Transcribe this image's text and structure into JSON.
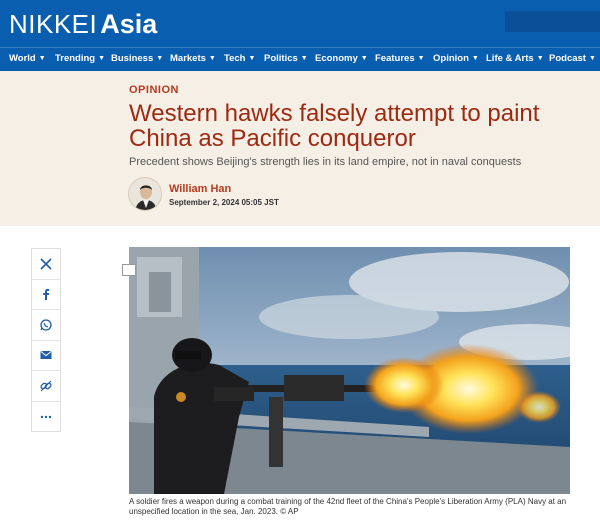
{
  "header": {
    "logo_primary": "NIKKEI",
    "logo_secondary": "Asia",
    "brand_color": "#0a5eb0"
  },
  "nav": {
    "items": [
      {
        "label": "World"
      },
      {
        "label": "Trending"
      },
      {
        "label": "Business"
      },
      {
        "label": "Markets"
      },
      {
        "label": "Tech"
      },
      {
        "label": "Politics"
      },
      {
        "label": "Economy"
      },
      {
        "label": "Features"
      },
      {
        "label": "Opinion"
      },
      {
        "label": "Life & Arts"
      },
      {
        "label": "Podcast"
      }
    ]
  },
  "article": {
    "kicker": "OPINION",
    "headline": "Western hawks falsely attempt to paint China as Pacific conqueror",
    "subhead": "Precedent shows Beijing's strength lies in its land empire, not in naval conquests",
    "author": "William Han",
    "date": "September 2, 2024 05:05 JST",
    "caption": "A soldier fires a weapon during a combat training of the 42nd fleet of the China's People's Liberation Army (PLA) Navy at an unspecified location in the sea, Jan. 2023.  © AP"
  },
  "share": {
    "icons": [
      "x-icon",
      "facebook-icon",
      "whatsapp-icon",
      "email-icon",
      "link-icon",
      "more-icon"
    ]
  },
  "colors": {
    "headline": "#9c2a12",
    "kicker": "#b23b1f",
    "band": "#f6efe6"
  }
}
